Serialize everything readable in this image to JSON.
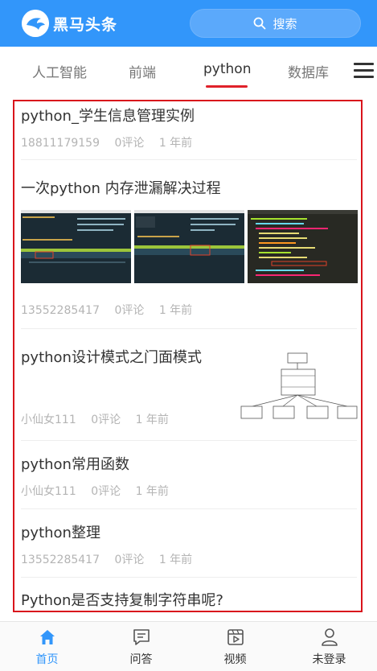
{
  "header": {
    "logo_text": "黑马头条",
    "search_label": "搜索"
  },
  "channels": [
    "人工智能",
    "前端",
    "python",
    "数据库"
  ],
  "active_channel": "python",
  "articles": [
    {
      "title": "python_学生信息管理实例",
      "author": "18811179159",
      "comments": "0评论",
      "time": "1 年前"
    },
    {
      "title": "一次python 内存泄漏解决过程",
      "author": "13552285417",
      "comments": "0评论",
      "time": "1 年前"
    },
    {
      "title": "python设计模式之门面模式",
      "author": "小仙女111",
      "comments": "0评论",
      "time": "1 年前"
    },
    {
      "title": "python常用函数",
      "author": "小仙女111",
      "comments": "0评论",
      "time": "1 年前"
    },
    {
      "title": "python整理",
      "author": "13552285417",
      "comments": "0评论",
      "time": "1 年前"
    },
    {
      "title": "Python是否支持复制字符串呢?",
      "author": "",
      "comments": "",
      "time": ""
    }
  ],
  "tabbar": [
    {
      "label": "首页",
      "icon": "home-icon"
    },
    {
      "label": "问答",
      "icon": "qa-icon"
    },
    {
      "label": "视频",
      "icon": "video-icon"
    },
    {
      "label": "未登录",
      "icon": "user-icon"
    }
  ],
  "colors": {
    "primary": "#3296fa",
    "highlight_border": "#d9141c",
    "tab_underline": "#e0212a"
  }
}
